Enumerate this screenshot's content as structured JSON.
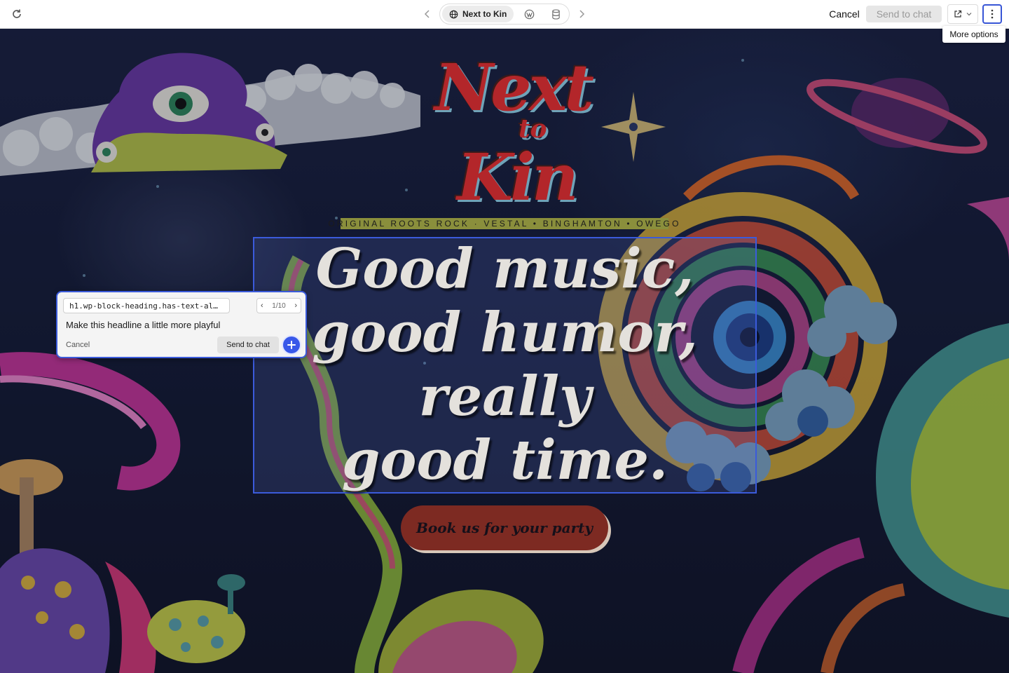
{
  "toolbar": {
    "site_label": "Next to Kin",
    "cancel_label": "Cancel",
    "send_label": "Send to chat",
    "more_tooltip": "More options"
  },
  "site": {
    "logo": "Next to Kin",
    "tagline": "ORIGINAL ROOTS ROCK · VESTAL • BINGHAMTON • OWEGO",
    "headline_lines": [
      "Good music,",
      "good humor,",
      "really",
      "good time."
    ],
    "cta_label": "Book us for your party"
  },
  "prompt": {
    "selector": "h1.wp-block-heading.has-text-al…",
    "pager": "1/10",
    "text": "Make this headline a little more playful",
    "cancel_label": "Cancel",
    "send_label": "Send to chat"
  },
  "colors": {
    "accent": "#3b5bdb",
    "logo_red": "#b3262a",
    "cta_bg": "#7d2a22",
    "headline": "#e4e1dc"
  },
  "icons": {
    "reload": "reload-icon",
    "globe": "globe-icon",
    "wordpress": "wordpress-icon",
    "database": "database-icon",
    "open_external": "external-link-icon",
    "more": "vertical-dots-icon",
    "add": "plus-icon"
  }
}
